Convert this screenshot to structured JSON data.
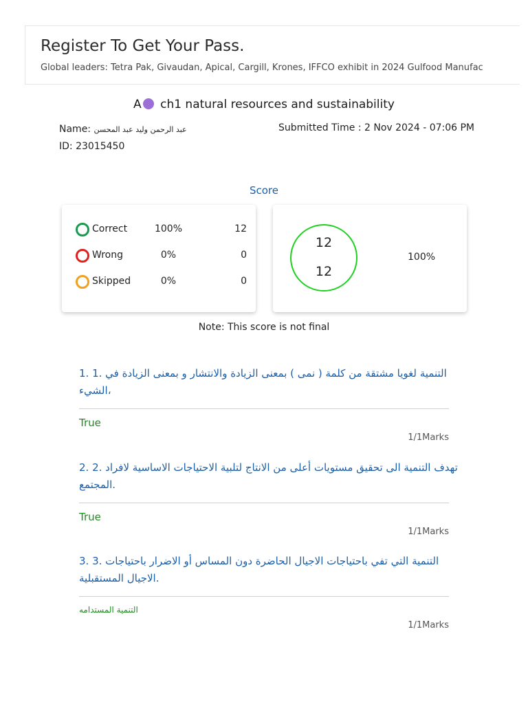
{
  "banner": {
    "title": "Register To Get Your Pass.",
    "subtitle": "Global leaders: Tetra Pak, Givaudan, Apical, Cargill, Krones, IFFCO exhibit in 2024 Gulfood Manufac"
  },
  "quiz": {
    "title_prefix": "A",
    "title": "ch1 natural resources and sustainability",
    "dot_color": "#9b6fd6",
    "name_label": "Name:",
    "name_value": "عبد الرحمن وليد عبد المحسن",
    "id_label": "ID:",
    "id_value": "23015450",
    "submitted_label": "Submitted Time :",
    "submitted_value": "2 Nov 2024 - 07:06 PM"
  },
  "score": {
    "label": "Score",
    "rows": [
      {
        "label": "Correct",
        "percent": "100%",
        "count": "12",
        "color": "#1a9a50"
      },
      {
        "label": "Wrong",
        "percent": "0%",
        "count": "0",
        "color": "#e02020"
      },
      {
        "label": "Skipped",
        "percent": "0%",
        "count": "0",
        "color": "#f0a020"
      }
    ],
    "circle_top": "12",
    "circle_bottom": "12",
    "circle_color": "#20d020",
    "total_percent": "100%",
    "note": "Note: This score is not final"
  },
  "questions": [
    {
      "line1": "1. 1. التنمية لغويا مشتقة من كلمة ( نمى ) بمعنى الزيادة والانتشار و بمعنى الزيادة في",
      "line2": "الشيء،",
      "answer": "True",
      "marks": "1/1Marks"
    },
    {
      "line1": "2. 2. تهدف التنمية الى تحقيق مستويات أعلى من الانتاج لتلبية الاحتياجات الاساسية لافراد",
      "line2": "المجتمع.",
      "answer": "True",
      "marks": "1/1Marks"
    },
    {
      "line1": "3. 3. التنمية التي تفي باحتياجات الاجيال الحاضرة دون المساس أو الاضرار باحتياجات",
      "line2": "الاجيال المستقبلية.",
      "answer": "التنمية المستدامه",
      "marks": "1/1Marks"
    }
  ]
}
